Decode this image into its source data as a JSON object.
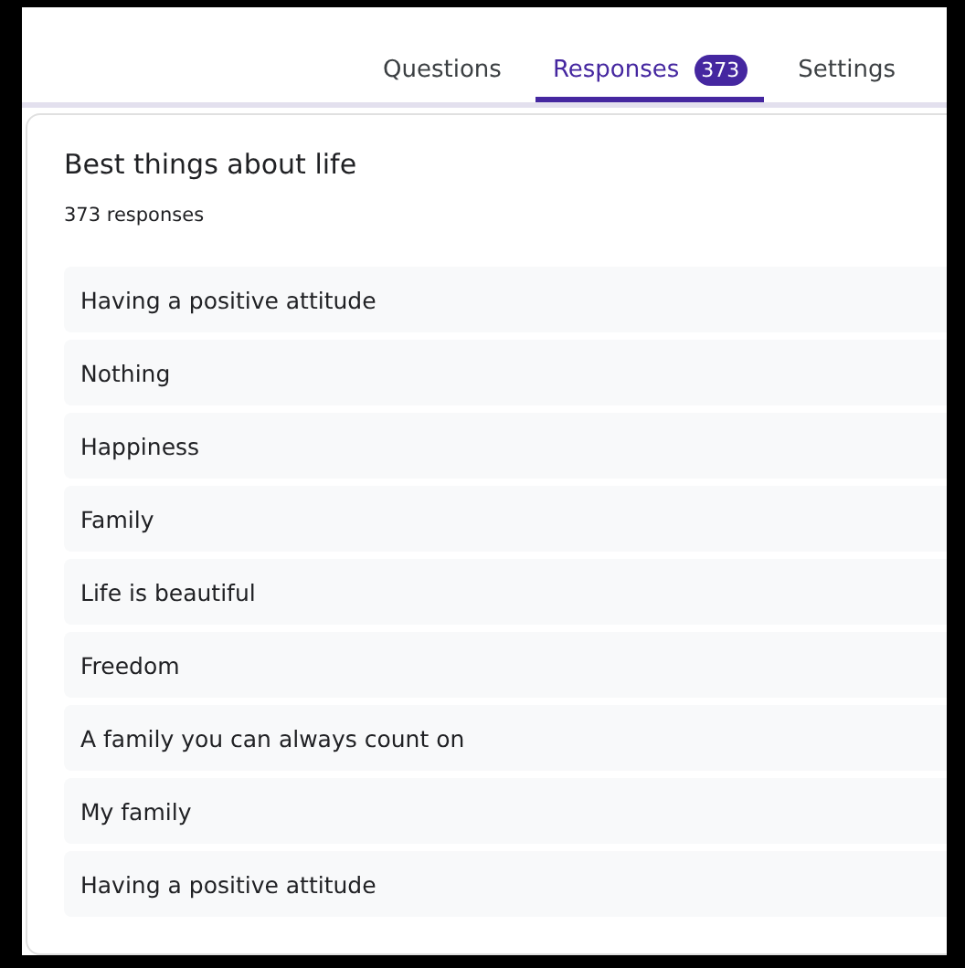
{
  "tabs": [
    {
      "label": "Questions",
      "selected": false
    },
    {
      "label": "Responses",
      "selected": true,
      "badge": "373"
    },
    {
      "label": "Settings",
      "selected": false
    }
  ],
  "question": {
    "title": "Best things about life",
    "count": "373 responses",
    "responses": [
      "Having a positive attitude",
      "Nothing",
      "Happiness",
      "Family",
      "Life is beautiful",
      "Freedom",
      "A family you can always count on",
      "My family",
      "Having a positive attitude"
    ]
  }
}
